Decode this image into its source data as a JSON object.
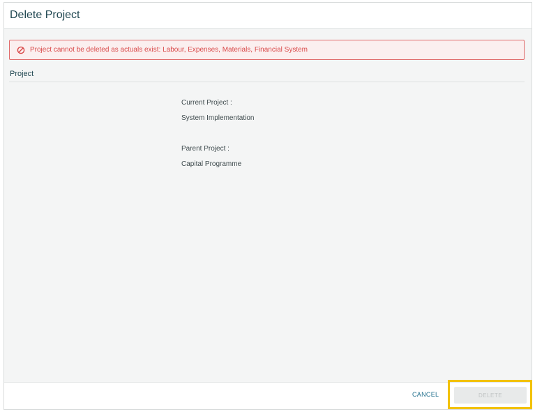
{
  "dialog": {
    "title": "Delete Project"
  },
  "error": {
    "icon": "blocked-icon",
    "message": "Project cannot be deleted as actuals exist: Labour, Expenses, Materials, Financial System",
    "color": "#d94848"
  },
  "section": {
    "title": "Project"
  },
  "fields": {
    "current_label": "Current Project :",
    "current_value": "System Implementation",
    "parent_label": "Parent Project :",
    "parent_value": "Capital Programme"
  },
  "footer": {
    "cancel_label": "CANCEL",
    "delete_label": "DELETE",
    "delete_state": "disabled",
    "highlight_color": "#f2c200"
  }
}
